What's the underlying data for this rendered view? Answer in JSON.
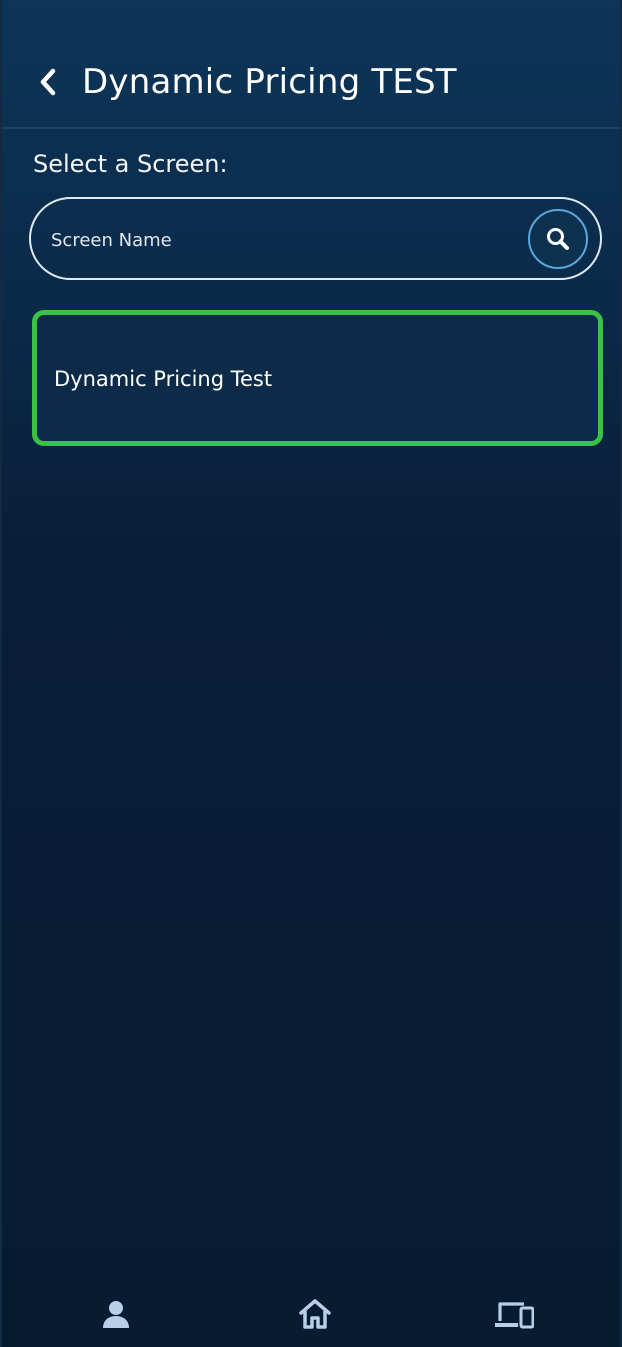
{
  "header": {
    "title": "Dynamic Pricing TEST",
    "back_icon": "chevron-left-icon"
  },
  "section": {
    "label": "Select a Screen:"
  },
  "search": {
    "placeholder": "Screen Name",
    "value": "",
    "icon": "search-icon"
  },
  "screens": [
    {
      "label": "Dynamic Pricing Test",
      "selected": true
    }
  ],
  "bottom_nav": {
    "items": [
      {
        "icon": "user-icon"
      },
      {
        "icon": "home-icon"
      },
      {
        "icon": "devices-icon"
      }
    ]
  },
  "colors": {
    "background_top": "#0d3559",
    "background_bottom": "#071b32",
    "selected_border": "#39c345",
    "search_button_border": "#5aa7dd",
    "icon_light": "#b9cfe8"
  }
}
